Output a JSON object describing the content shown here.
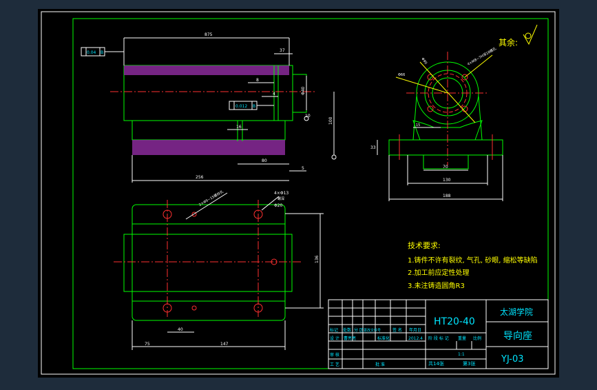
{
  "drawing": {
    "roughness_symbol": "其余:",
    "tech_req": {
      "title": "技术要求:",
      "items": [
        "1.铸件不许有裂纹, 气孔, 砂眼, 缩松等缺陷",
        "2.加工前应定性处理",
        "3.未注铸造圆角R3"
      ]
    },
    "title_block": {
      "material": "HT20-40",
      "school": "太湖学院",
      "part_name": "导向座",
      "drawing_no": "YJ-03",
      "scale": "1:1",
      "sheet_total": "共14张",
      "sheet_no": "第3张",
      "header_labels": [
        "标记",
        "处数",
        "分 区",
        "更改文件号",
        "签 名",
        "年月日"
      ],
      "row_labels": [
        "设 计",
        "审 核",
        "工 艺",
        "批 准"
      ],
      "designer": "曹亮亮",
      "std_label": "标准化",
      "date": "2012.4",
      "stage_labels": [
        "阶 段 标 记",
        "重量",
        "比例"
      ]
    },
    "dimensions": {
      "front_top": "875",
      "front_right_top": "37",
      "front_8": "8",
      "front_4": "4",
      "front_phi": "Φ40",
      "front_10": "10",
      "front_height": "100",
      "front_16": "16",
      "front_80": "80",
      "front_5": "5",
      "front_bottom": "256",
      "tol1": "0.04",
      "tol1_ref": "B",
      "tol2": "0.012",
      "tol2_ref": "B",
      "plan_thread": "2×Φ9~15螺纹孔",
      "plan_holes": "4×Φ13",
      "plan_holes2": "螺深",
      "plan_phi20": "Φ20",
      "plan_height": "136",
      "plan_40": "40",
      "plan_75": "75",
      "plan_147": "147",
      "side_phi90": "Φ90",
      "side_phi66": "Φ66",
      "side_m": "4×M8~7H深18螺孔",
      "side_15": "15",
      "side_33": "33",
      "side_70": "70",
      "side_130": "130",
      "side_188": "188"
    }
  }
}
